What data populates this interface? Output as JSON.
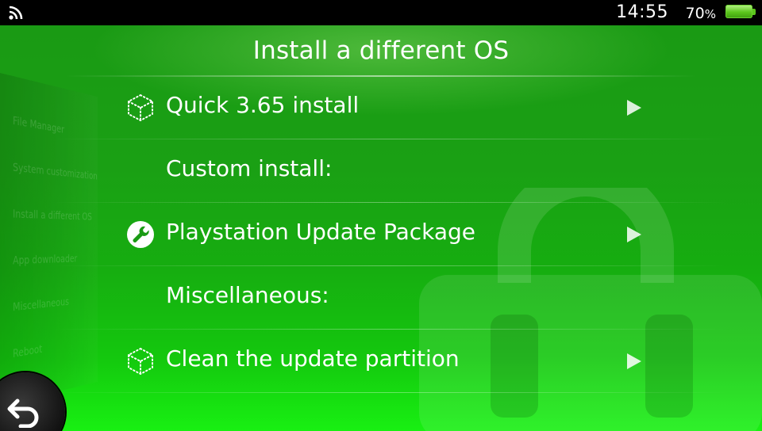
{
  "status_bar": {
    "time": "14:55",
    "battery_percent": "70",
    "battery_unit": "%",
    "wifi_icon": "wifi-icon",
    "battery_icon": "battery-icon"
  },
  "page": {
    "title": "Install a different OS"
  },
  "menu": {
    "items": [
      {
        "label": "Quick 3.65 install",
        "icon": "dotted-cube-icon",
        "selectable": true
      },
      {
        "label": "Custom install:",
        "selectable": false
      },
      {
        "label": "Playstation Update Package",
        "icon": "wrench-icon",
        "selectable": true
      },
      {
        "label": "Miscellaneous:",
        "selectable": false
      },
      {
        "label": "Clean the update partition",
        "icon": "dotted-cube-icon",
        "selectable": true
      }
    ]
  },
  "background_menu": {
    "items": [
      "File Manager",
      "System customization",
      "Install a different OS",
      "App downloader",
      "Miscellaneous",
      "Reboot"
    ]
  },
  "colors": {
    "accent": "#1aa014",
    "accent_bright": "#18f012",
    "text": "#ffffff"
  }
}
